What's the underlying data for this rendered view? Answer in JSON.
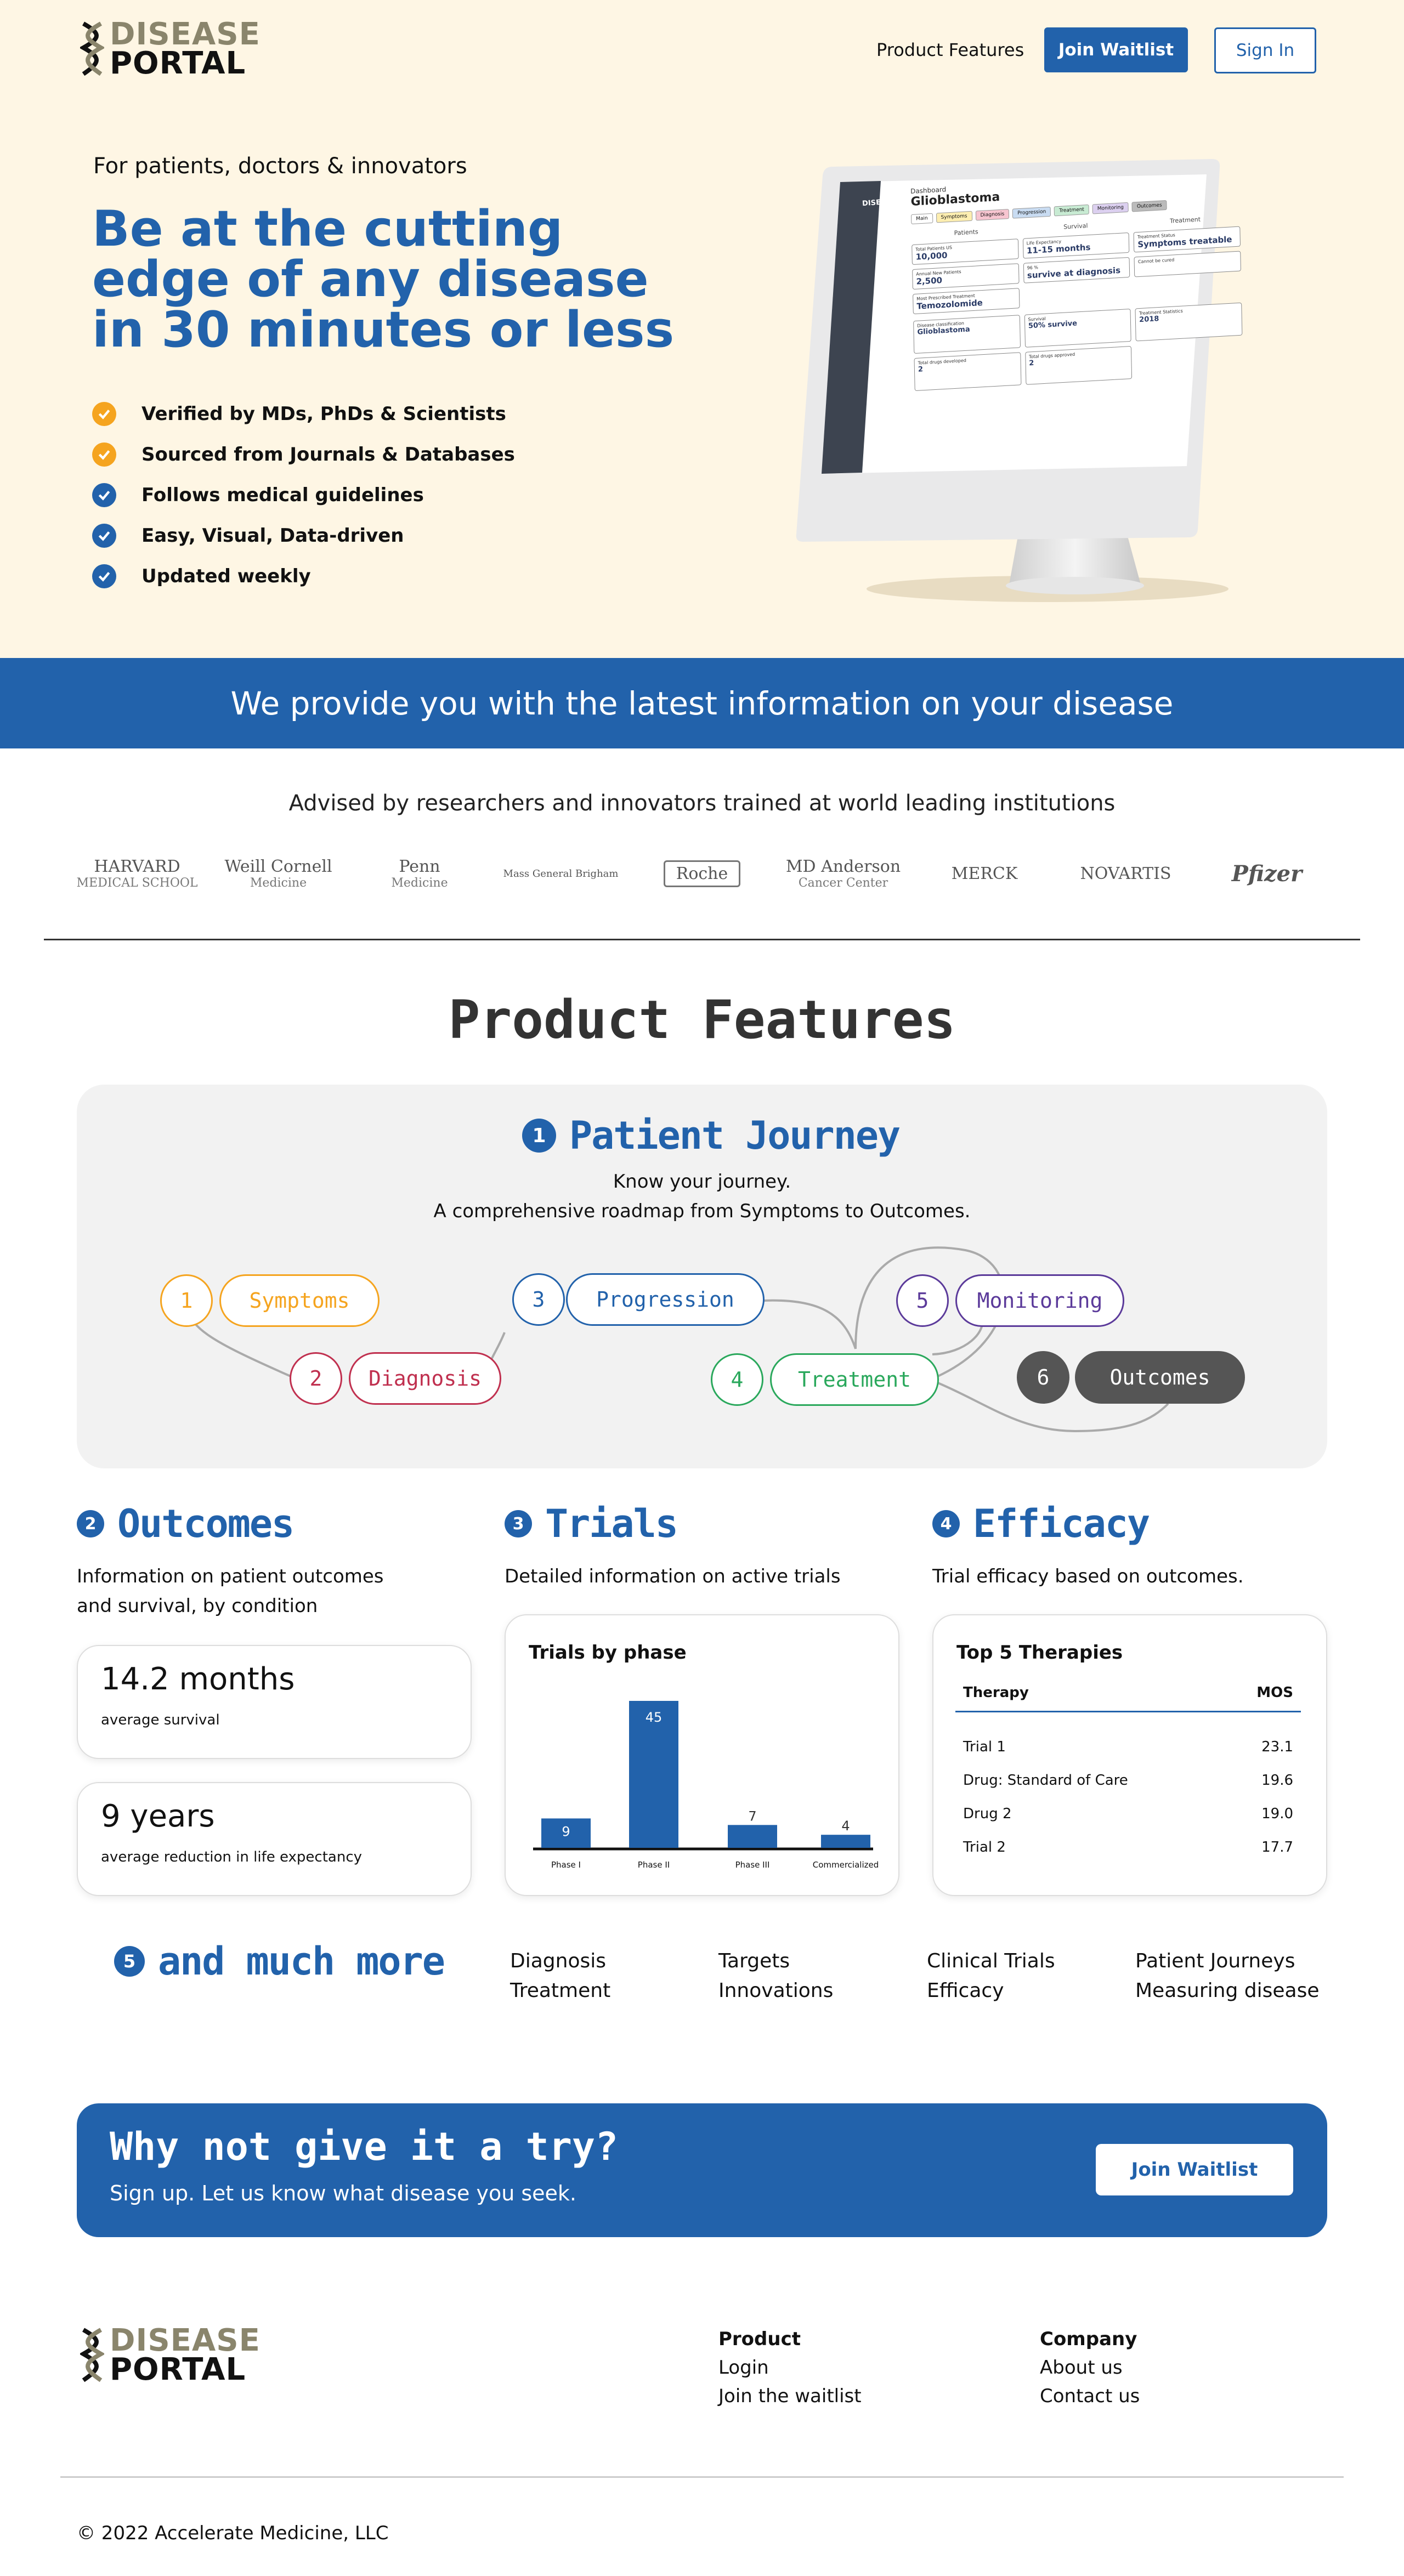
{
  "brand": {
    "line1": "DISEASE",
    "line2": "PORTAL"
  },
  "nav": {
    "features": "Product Features",
    "waitlist": "Join Waitlist",
    "signin": "Sign In"
  },
  "hero": {
    "subtitle": "For patients, doctors & innovators",
    "title": "Be at the cutting edge of any disease in 30 minutes or less",
    "checks": [
      {
        "label": "Verified by MDs, PhDs & Scientists",
        "color": "#f5a41f"
      },
      {
        "label": "Sourced from Journals & Databases",
        "color": "#f5a41f"
      },
      {
        "label": "Follows medical guidelines",
        "color": "#2262ab"
      },
      {
        "label": "Easy, Visual, Data-driven",
        "color": "#2262ab"
      },
      {
        "label": "Updated weekly",
        "color": "#2262ab"
      }
    ]
  },
  "mockup": {
    "crumb": "Dashboard",
    "disease": "Glioblastoma",
    "logo": "DISEASE PORTAL",
    "tabs": [
      "Main",
      "Symptoms",
      "Diagnosis",
      "Progression",
      "Treatment",
      "Monitoring",
      "Outcomes"
    ],
    "col_heads": [
      "Patients",
      "Survival",
      "Treatment"
    ],
    "cards": [
      {
        "label": "Total Patients US",
        "value": "10,000"
      },
      {
        "label": "Life Expectancy",
        "value": "11-15 months"
      },
      {
        "label": "Treatment Status",
        "value": "Symptoms treatable"
      },
      {
        "label": "Annual New Patients",
        "value": "2,500"
      },
      {
        "label": "96 %",
        "value": "survive at diagnosis"
      },
      {
        "label": "Cannot be cured",
        "value": ""
      },
      {
        "label": "Most Prescribed Treatment",
        "value": "Temozolomide"
      }
    ],
    "lower": [
      {
        "label": "Disease classification",
        "value": "Glioblastoma"
      },
      {
        "label": "Survival",
        "value": "50% survive"
      },
      {
        "label": "Treatment Statistics",
        "value": "2018"
      },
      {
        "label": "Total drugs developed",
        "value": "2"
      },
      {
        "label": "Total drugs approved",
        "value": "2"
      }
    ]
  },
  "banner": "We provide you with the latest information on your disease",
  "advised": "Advised by researchers and innovators trained at world leading institutions",
  "institutions": [
    {
      "line1": "HARVARD",
      "line2": "MEDICAL SCHOOL"
    },
    {
      "line1": "Weill Cornell",
      "line2": "Medicine"
    },
    {
      "line1": "Penn",
      "line2": "Medicine"
    },
    {
      "line1": "Mass General Brigham",
      "line2": ""
    },
    {
      "line1": "Roche",
      "line2": ""
    },
    {
      "line1": "MD Anderson",
      "line2": "Cancer Center"
    },
    {
      "line1": "MERCK",
      "line2": ""
    },
    {
      "line1": "NOVARTIS",
      "line2": ""
    },
    {
      "line1": "Pfizer",
      "line2": ""
    }
  ],
  "features": {
    "title": "Product Features",
    "journey": {
      "num": "1",
      "title": "Patient Journey",
      "line1": "Know your journey.",
      "line2": "A comprehensive roadmap from Symptoms to Outcomes.",
      "steps": [
        {
          "n": "1",
          "label": "Symptoms",
          "color": "#f5a41f"
        },
        {
          "n": "2",
          "label": "Diagnosis",
          "color": "#c0304f"
        },
        {
          "n": "3",
          "label": "Progression",
          "color": "#2262ab"
        },
        {
          "n": "4",
          "label": "Treatment",
          "color": "#2aa85c"
        },
        {
          "n": "5",
          "label": "Monitoring",
          "color": "#5b3a9a"
        },
        {
          "n": "6",
          "label": "Outcomes",
          "color": "#555555"
        }
      ]
    },
    "outcomes": {
      "num": "2",
      "title": "Outcomes",
      "desc1": "Information on patient outcomes",
      "desc2": "and survival, by condition",
      "stat1_value": "14.2 months",
      "stat1_label": "average survival",
      "stat2_value": "9 years",
      "stat2_label": "average reduction in life expectancy"
    },
    "trials": {
      "num": "3",
      "title": "Trials",
      "desc": "Detailed information on active trials"
    },
    "efficacy": {
      "num": "4",
      "title": "Efficacy",
      "desc": "Trial efficacy based on outcomes.",
      "table_title": "Top 5 Therapies",
      "col_therapy": "Therapy",
      "col_mos": "MOS",
      "rows": [
        {
          "therapy": "Trial 1",
          "mos": "23.1"
        },
        {
          "therapy": "Drug: Standard of Care",
          "mos": "19.6"
        },
        {
          "therapy": "Drug 2",
          "mos": "19.0"
        },
        {
          "therapy": "Trial 2",
          "mos": "17.7"
        }
      ]
    },
    "more": {
      "num": "5",
      "title": "and much more",
      "items": [
        "Diagnosis",
        "Treatment",
        "Targets",
        "Innovations",
        "Clinical Trials",
        "Efficacy",
        "Patient Journeys",
        "Measuring disease"
      ]
    }
  },
  "chart_data": {
    "type": "bar",
    "title": "Trials by phase",
    "categories": [
      "Phase I",
      "Phase II",
      "Phase III",
      "Commercialized"
    ],
    "values": [
      9,
      45,
      7,
      4
    ],
    "color": "#2262ab",
    "ylim": [
      0,
      45
    ]
  },
  "cta": {
    "title": "Why not give it a try?",
    "subtitle": "Sign up. Let us know what disease you seek.",
    "button": "Join Waitlist"
  },
  "footer": {
    "product_head": "Product",
    "product_links": [
      "Login",
      "Join the waitlist"
    ],
    "company_head": "Company",
    "company_links": [
      "About us",
      "Contact us"
    ],
    "copyright": "© 2022 Accelerate Medicine, LLC"
  },
  "colors": {
    "brand_blue": "#2262ab",
    "hero_bg": "#fef6e4",
    "accent_orange": "#f5a41f"
  }
}
